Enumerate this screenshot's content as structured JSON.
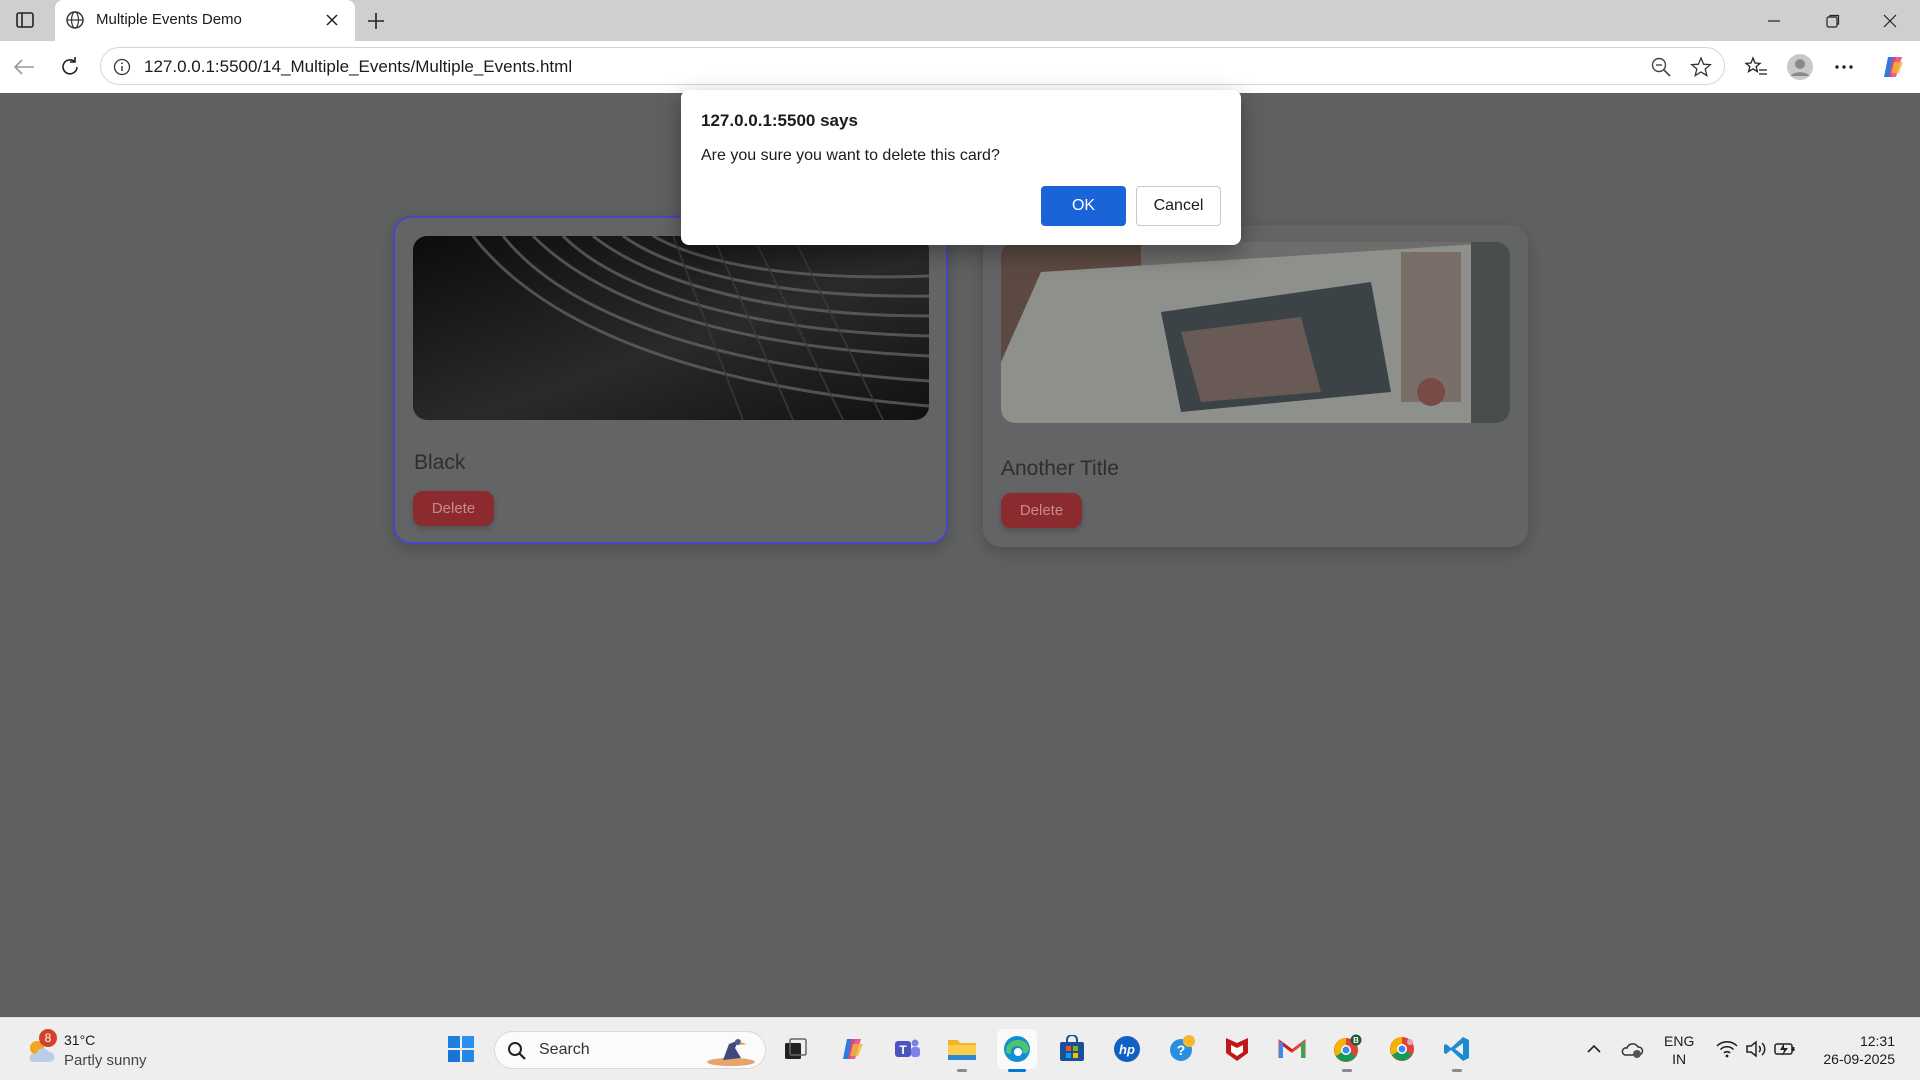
{
  "browser": {
    "tab_title": "Multiple Events Demo",
    "url": "127.0.0.1:5500/14_Multiple_Events/Multiple_Events.html"
  },
  "page": {
    "cards": [
      {
        "title": "Black",
        "delete_label": "Delete"
      },
      {
        "title": "Another Title",
        "delete_label": "Delete"
      }
    ]
  },
  "dialog": {
    "title": "127.0.0.1:5500 says",
    "message": "Are you sure you want to delete this card?",
    "ok_label": "OK",
    "cancel_label": "Cancel"
  },
  "taskbar": {
    "weather_temp": "31°C",
    "weather_condition": "Partly sunny",
    "weather_badge": "8",
    "search_label": "Search",
    "lang_line1": "ENG",
    "lang_line2": "IN",
    "time": "12:31",
    "date": "26-09-2025"
  },
  "colors": {
    "accent": "#1a63d8",
    "card_focus_border": "#4b46c9",
    "delete_button": "#8b2b2f",
    "edge_blue": "#0078d4"
  }
}
